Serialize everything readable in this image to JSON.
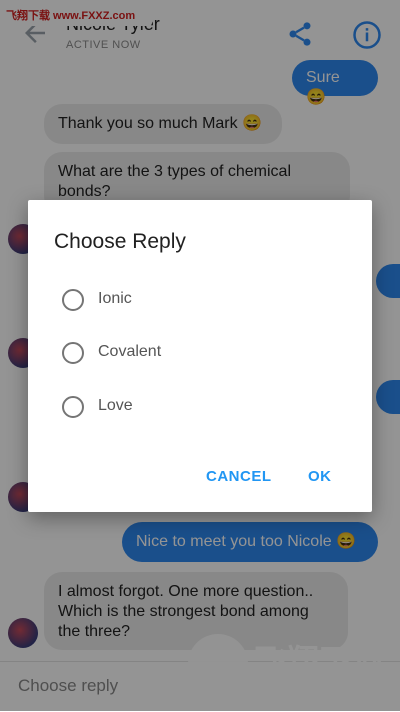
{
  "watermark_top": "飞翔下载 www.FXXZ.com",
  "header": {
    "contact_name": "Nicole Tyler",
    "status": "ACTIVE NOW"
  },
  "messages": [
    {
      "from": "me",
      "text": "Sure 😄"
    },
    {
      "from": "them",
      "text": "Thank you so much Mark 😄"
    },
    {
      "from": "them",
      "text": "What are the 3 types of chemical bonds?"
    },
    {
      "from": "me",
      "text": "Nice to meet you too Nicole 😄"
    },
    {
      "from": "them",
      "text": "I almost forgot. One more question.. Which is the strongest bond among the three?"
    }
  ],
  "composer": {
    "label": "Choose reply"
  },
  "dialog": {
    "title": "Choose Reply",
    "options": [
      "Ionic",
      "Covalent",
      "Love"
    ],
    "cancel_label": "CANCEL",
    "ok_label": "OK"
  },
  "watermark_bottom": {
    "text": "飞翔下载",
    "url": "www.fxxz.com"
  },
  "colors": {
    "accent": "#2196f3",
    "bubble_out": "#2d88f0",
    "bubble_in": "#ebebeb"
  }
}
